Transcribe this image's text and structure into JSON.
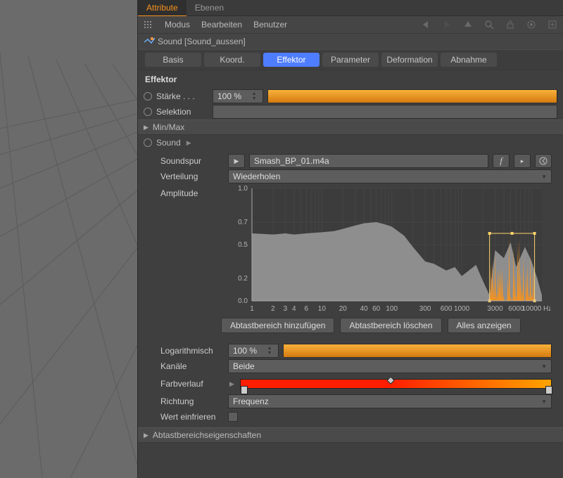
{
  "panel_tabs": {
    "attribute": "Attribute",
    "layers": "Ebenen"
  },
  "toolbar_menu": {
    "mode": "Modus",
    "edit": "Bearbeiten",
    "user": "Benutzer"
  },
  "object_name": "Sound [Sound_aussen]",
  "subtabs": {
    "basis": "Basis",
    "koord": "Koord.",
    "effektor": "Effektor",
    "parameter": "Parameter",
    "deformation": "Deformation",
    "abnahme": "Abnahme"
  },
  "section_title": "Effektor",
  "strength": {
    "label": "Stärke . . .",
    "value": "100 %",
    "fill_pct": 100
  },
  "selection_label": "Selektion",
  "minmax_label": "Min/Max",
  "sound": {
    "header": "Sound",
    "track_label": "Soundspur",
    "track_value": "Smash_BP_01.m4a",
    "dist_label": "Verteilung",
    "dist_value": "Wiederholen",
    "amplitude_label": "Amplitude"
  },
  "chart_data": {
    "type": "area",
    "xscale": "log",
    "xlim": [
      1,
      14000
    ],
    "ylim": [
      0,
      1.0
    ],
    "ylabel": "",
    "xunit": "Hz",
    "yticks": [
      0.0,
      0.2,
      0.5,
      0.7,
      1.0
    ],
    "xticks": [
      1,
      2,
      3,
      4,
      6,
      10,
      20,
      40,
      60,
      100,
      300,
      600,
      1000,
      3000,
      6000,
      10000
    ],
    "spectrum": [
      {
        "hz": 1,
        "a": 0.6
      },
      {
        "hz": 2,
        "a": 0.59
      },
      {
        "hz": 3,
        "a": 0.6
      },
      {
        "hz": 4,
        "a": 0.59
      },
      {
        "hz": 6,
        "a": 0.6
      },
      {
        "hz": 10,
        "a": 0.61
      },
      {
        "hz": 15,
        "a": 0.62
      },
      {
        "hz": 20,
        "a": 0.64
      },
      {
        "hz": 30,
        "a": 0.67
      },
      {
        "hz": 40,
        "a": 0.69
      },
      {
        "hz": 60,
        "a": 0.7
      },
      {
        "hz": 80,
        "a": 0.68
      },
      {
        "hz": 100,
        "a": 0.66
      },
      {
        "hz": 150,
        "a": 0.58
      },
      {
        "hz": 200,
        "a": 0.48
      },
      {
        "hz": 300,
        "a": 0.35
      },
      {
        "hz": 400,
        "a": 0.33
      },
      {
        "hz": 600,
        "a": 0.27
      },
      {
        "hz": 800,
        "a": 0.3
      },
      {
        "hz": 1000,
        "a": 0.22
      },
      {
        "hz": 1600,
        "a": 0.32
      },
      {
        "hz": 2000,
        "a": 0.18
      },
      {
        "hz": 2500,
        "a": 0.05
      },
      {
        "hz": 3000,
        "a": 0.45
      },
      {
        "hz": 4000,
        "a": 0.38
      },
      {
        "hz": 5000,
        "a": 0.52
      },
      {
        "hz": 6000,
        "a": 0.3
      },
      {
        "hz": 8000,
        "a": 0.48
      },
      {
        "hz": 10000,
        "a": 0.35
      },
      {
        "hz": 12000,
        "a": 0.2
      },
      {
        "hz": 14000,
        "a": 0.05
      }
    ],
    "selection_hz": [
      2500,
      11000
    ],
    "selection_a": 0.6
  },
  "buttons": {
    "add": "Abtastbereich hinzufügen",
    "del": "Abtastbereich löschen",
    "all": "Alles anzeigen"
  },
  "log": {
    "label": "Logarithmisch",
    "value": "100 %",
    "fill_pct": 100
  },
  "channels": {
    "label": "Kanäle",
    "value": "Beide"
  },
  "gradient": {
    "label": "Farbverlauf",
    "stops": [
      {
        "pos": 0,
        "color": "#ff1e00"
      },
      {
        "pos": 48,
        "color": "#ff1e00"
      },
      {
        "pos": 100,
        "color": "#ffa400"
      }
    ]
  },
  "direction": {
    "label": "Richtung",
    "value": "Frequenz"
  },
  "freeze_label": "Wert einfrieren",
  "sample_props_label": "Abtastbereichseigenschaften"
}
